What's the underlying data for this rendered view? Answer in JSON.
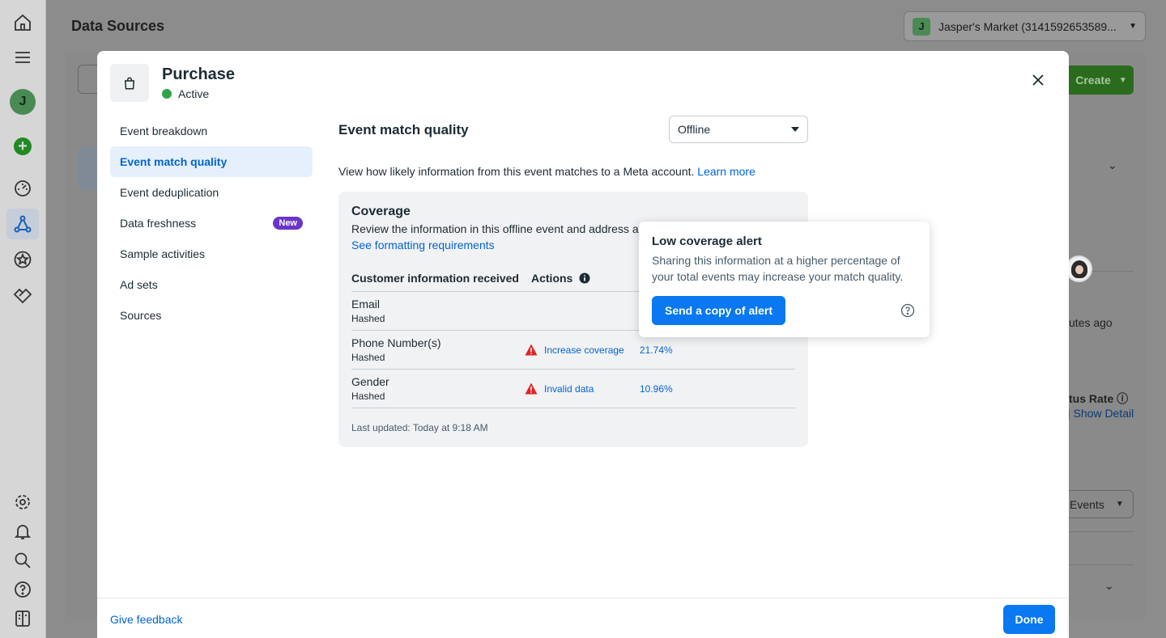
{
  "background": {
    "page_title": "Data Sources",
    "account_selector": {
      "initial": "J",
      "label": "Jasper's Market (3141592653589..."
    },
    "create_label": "Create",
    "right_texts": {
      "minutes_ago": "utes ago",
      "status_rate": "tus Rate",
      "show_detail": "Show Detail",
      "events_label": "Events"
    }
  },
  "modal": {
    "event_name": "Purchase",
    "status": "Active",
    "nav": [
      {
        "label": "Event breakdown"
      },
      {
        "label": "Event match quality"
      },
      {
        "label": "Event deduplication"
      },
      {
        "label": "Data freshness",
        "badge": "New"
      },
      {
        "label": "Sample activities"
      },
      {
        "label": "Ad sets"
      },
      {
        "label": "Sources"
      }
    ],
    "section_title": "Event match quality",
    "source_select": "Offline",
    "description": "View how likely information from this event matches to a Meta account.",
    "learn_more": "Learn more",
    "coverage": {
      "title": "Coverage",
      "subtitle": "Review the information in this offline event and address a",
      "formatting_link": "See formatting requirements",
      "columns": {
        "info": "Customer information received",
        "actions": "Actions"
      },
      "rows": [
        {
          "name": "Email",
          "sub": "Hashed",
          "action": "",
          "pct": ""
        },
        {
          "name": "Phone Number(s)",
          "sub": "Hashed",
          "action": "Increase coverage",
          "pct": "21.74%"
        },
        {
          "name": "Gender",
          "sub": "Hashed",
          "action": "Invalid data",
          "pct": "10.96%"
        }
      ],
      "last_updated": "Last updated: Today at 9:18 AM"
    },
    "tooltip": {
      "title": "Low coverage alert",
      "text": "Sharing this information at a higher percentage of your total events may increase your match quality.",
      "button": "Send a copy of alert"
    },
    "footer": {
      "feedback": "Give feedback",
      "done": "Done"
    }
  },
  "colors": {
    "accent": "#0a78f0",
    "link": "#0064d1",
    "active_status": "#31a24c",
    "warning": "#e02424",
    "badge": "#6b34c8"
  }
}
